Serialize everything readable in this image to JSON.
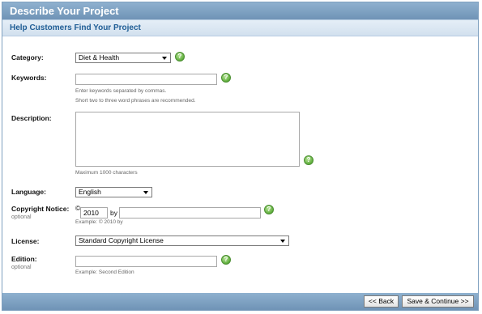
{
  "header": {
    "title": "Describe Your Project",
    "subtitle": "Help Customers Find Your Project"
  },
  "form": {
    "category": {
      "label": "Category:",
      "value": "Diet & Health"
    },
    "keywords": {
      "label": "Keywords:",
      "value": "",
      "hint1": "Enter keywords separated by commas.",
      "hint2": "Short two to three word phrases are recommended."
    },
    "description": {
      "label": "Description:",
      "value": "",
      "hint": "Maximum 1000 characters"
    },
    "language": {
      "label": "Language:",
      "value": "English"
    },
    "copyright": {
      "label": "Copyright Notice:",
      "sublabel": "optional",
      "symbol": "©",
      "year": "2010",
      "by_label": "by",
      "owner": "",
      "hint": "Example: © 2010 by"
    },
    "license": {
      "label": "License:",
      "value": "Standard Copyright License"
    },
    "edition": {
      "label": "Edition:",
      "sublabel": "optional",
      "value": "",
      "hint": "Example: Second Edition"
    },
    "help_glyph": "?"
  },
  "footer": {
    "back_label": "<< Back",
    "continue_label": "Save & Continue >>"
  },
  "colors": {
    "header_bar": "#7fa3c4",
    "subtitle_text": "#1f5d95",
    "help_icon": "#5fae3c"
  },
  "icons": {
    "help": "help-question-icon",
    "dropdown": "chevron-down-icon"
  }
}
